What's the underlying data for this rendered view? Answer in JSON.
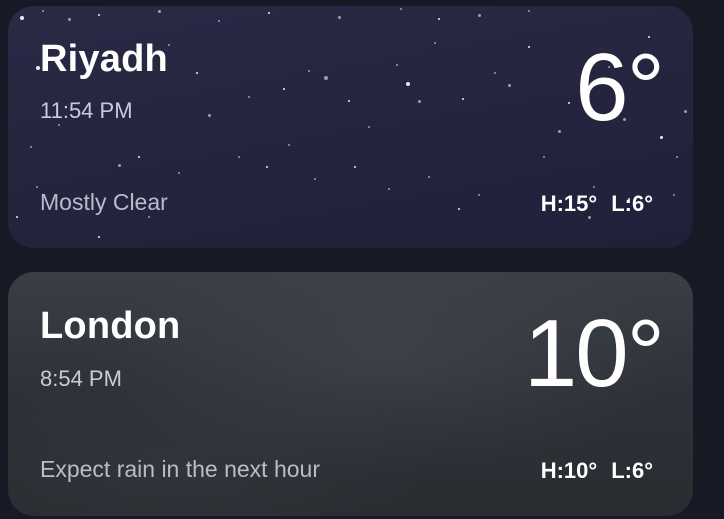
{
  "locations": [
    {
      "city": "Riyadh",
      "time": "11:54 PM",
      "temperature": "6°",
      "condition": "Mostly Clear",
      "high": "H:15°",
      "low": "L:6°"
    },
    {
      "city": "London",
      "time": "8:54 PM",
      "temperature": "10°",
      "condition": "Expect rain in the next hour",
      "high": "H:10°",
      "low": "L:6°"
    }
  ],
  "colors": {
    "page_background": "#171a24",
    "night_card": "#24243e",
    "cloudy_card": "#2e3238",
    "secondary_text": "#c9cbd8"
  }
}
